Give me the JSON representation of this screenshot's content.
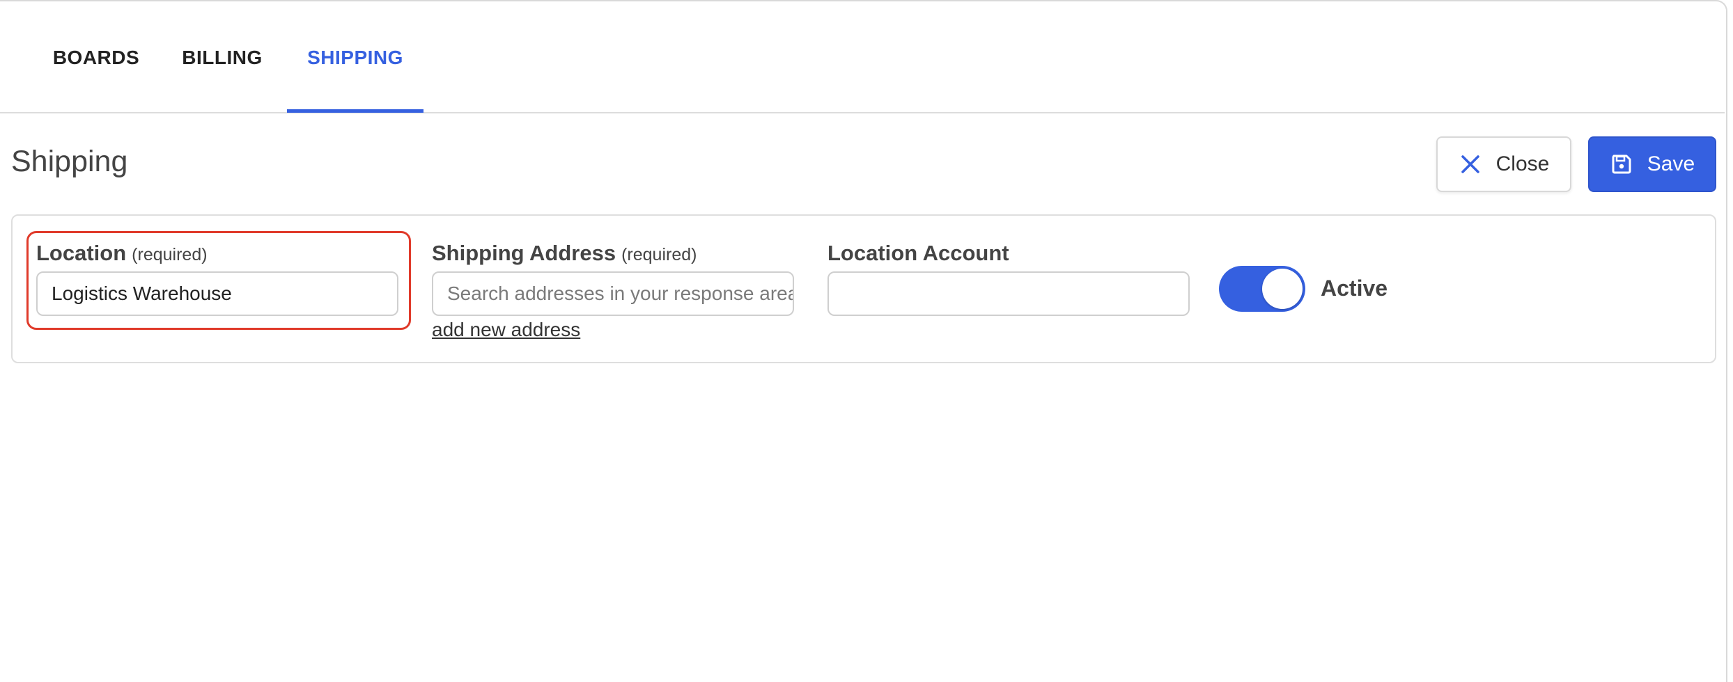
{
  "tabs": [
    {
      "label": "BOARDS",
      "active": false
    },
    {
      "label": "BILLING",
      "active": false
    },
    {
      "label": "SHIPPING",
      "active": true
    }
  ],
  "header": {
    "title": "Shipping",
    "close_label": "Close",
    "save_label": "Save"
  },
  "form": {
    "location": {
      "label": "Location",
      "required_note": "(required)",
      "value": "Logistics Warehouse"
    },
    "shipping_address": {
      "label": "Shipping Address",
      "required_note": "(required)",
      "placeholder": "Search addresses in your response area",
      "add_link": "add new address"
    },
    "location_account": {
      "label": "Location Account",
      "value": ""
    },
    "active_toggle": {
      "label": "Active",
      "on": true
    }
  },
  "colors": {
    "accent": "#3560e0",
    "highlight_border": "#e03a2a",
    "text": "#444444"
  },
  "icons": {
    "close": "close-icon",
    "save": "save-icon"
  }
}
